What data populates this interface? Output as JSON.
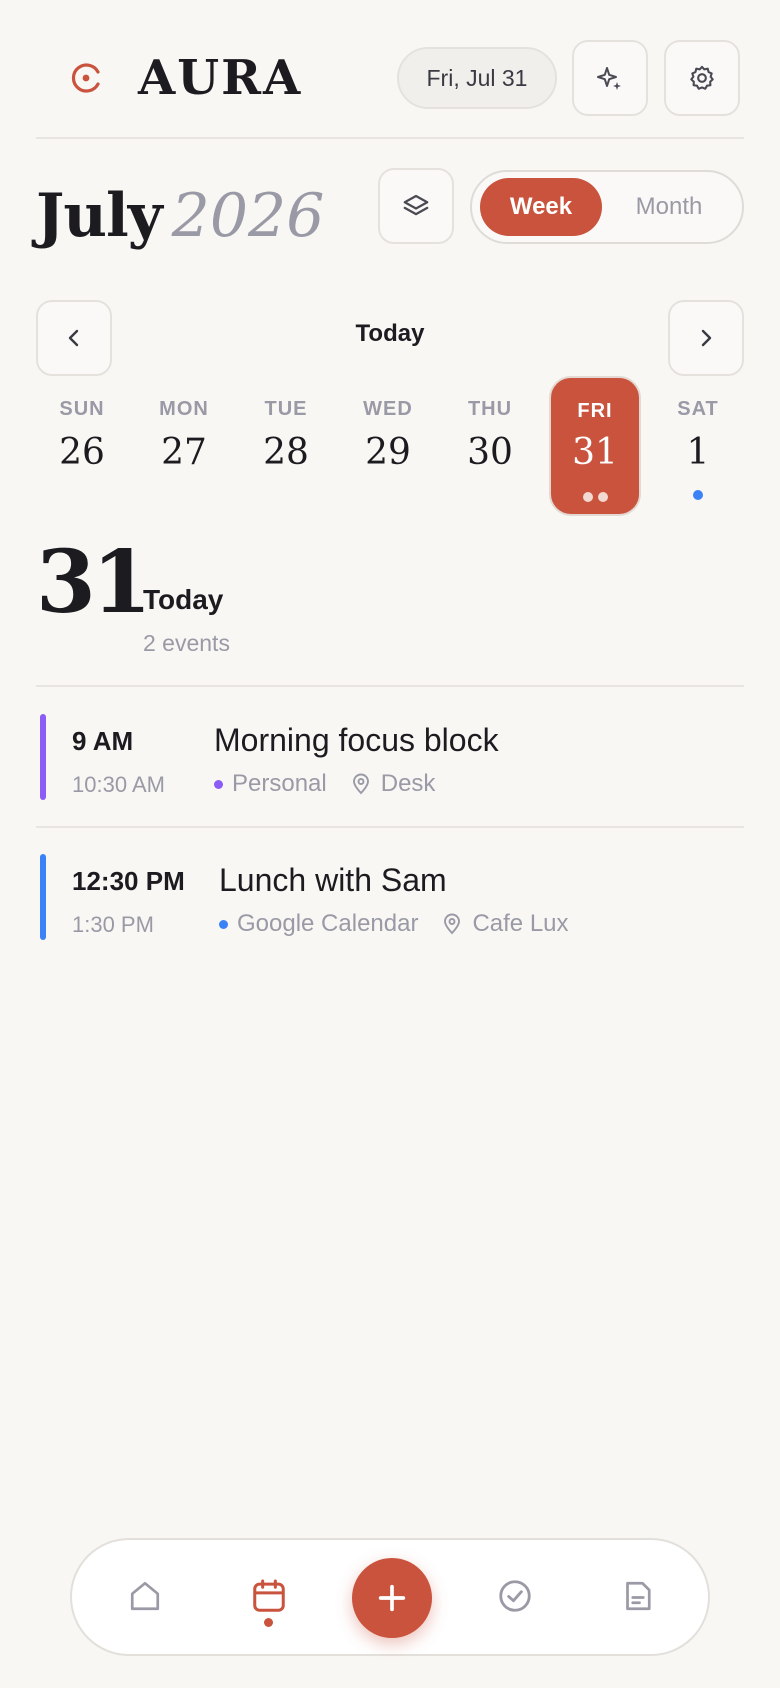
{
  "header": {
    "brand": "AURA",
    "date_pill": "Fri, Jul 31"
  },
  "calendar": {
    "month": "July",
    "year": "2026",
    "view_toggle": {
      "week_label": "Week",
      "month_label": "Month",
      "selected": "Week"
    },
    "today_label": "Today",
    "days": [
      {
        "name": "SUN",
        "date": "26",
        "dots": []
      },
      {
        "name": "MON",
        "date": "27",
        "dots": []
      },
      {
        "name": "TUE",
        "date": "28",
        "dots": []
      },
      {
        "name": "WED",
        "date": "29",
        "dots": []
      },
      {
        "name": "THU",
        "date": "30",
        "dots": []
      },
      {
        "name": "FRI",
        "date": "31",
        "dots": [
          "#F2D9D2",
          "#F2D9D2"
        ],
        "selected": true
      },
      {
        "name": "SAT",
        "date": "1",
        "dots": [
          "#3B82F6"
        ]
      }
    ]
  },
  "day_summary": {
    "big_date": "31",
    "label": "Today",
    "event_count": "2 events"
  },
  "events": [
    {
      "start": "9 AM",
      "end": "10:30 AM",
      "title": "Morning focus block",
      "calendar": "Personal",
      "location": "Desk",
      "color": "#8B5CF6"
    },
    {
      "start": "12:30 PM",
      "end": "1:30 PM",
      "title": "Lunch with Sam",
      "calendar": "Google Calendar",
      "location": "Cafe Lux",
      "color": "#3B82F6"
    }
  ],
  "colors": {
    "accent": "#C9533D",
    "muted": "#9A9AA6",
    "background": "#F9F7F4"
  },
  "tabbar": {
    "tabs": [
      "home-icon",
      "calendar-icon",
      "add-icon",
      "check-circle-icon",
      "document-icon"
    ],
    "active": "calendar-icon"
  }
}
